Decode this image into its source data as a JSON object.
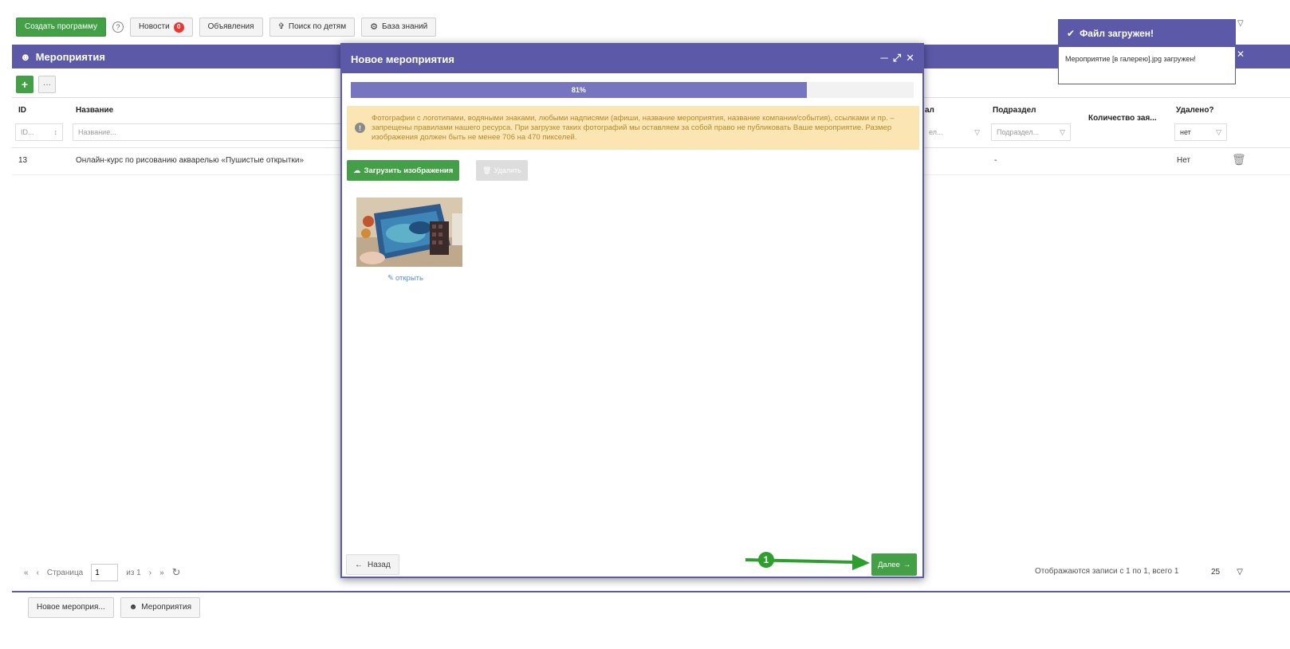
{
  "toolbar": {
    "create_program": "Создать программу",
    "help": "?",
    "news": "Новости",
    "news_badge": "0",
    "announcements": "Объявления",
    "search_children": "Поиск по детям",
    "knowledge_base": "База знаний"
  },
  "panel": {
    "title": "Мероприятия",
    "add": "+",
    "more": "···"
  },
  "grid": {
    "columns": {
      "id": "ID",
      "name": "Название",
      "col_partial": "ал",
      "subsection": "Подраздел",
      "applications_count": "Количество зая...",
      "deleted": "Удалено?"
    },
    "filters": {
      "id_placeholder": "ID...",
      "name_placeholder": "Название...",
      "partial_placeholder": "ел...",
      "subsection_placeholder": "Подраздел...",
      "deleted_value": "нет"
    },
    "rows": [
      {
        "id": "13",
        "name": "Онлайн-курс по рисованию акварелью «Пушистые открытки»",
        "subsection": "-",
        "deleted": "Нет"
      }
    ]
  },
  "pager": {
    "page_label": "Страница",
    "page_value": "1",
    "of_label": "из 1",
    "status": "Отображаются записи с 1 по 1, всего 1",
    "per_page": "25"
  },
  "tabs": {
    "new_event": "Новое мероприя...",
    "events": "Мероприятия"
  },
  "notification": {
    "title": "Файл загружен!",
    "message": "Мероприятие [в галерею].jpg загружен!"
  },
  "modal": {
    "title": "Новое мероприятия",
    "progress_label": "81%",
    "progress_value": 81,
    "warning": "Фотографии с логотипами, водяными знаками, любыми надписями (афиши, название мероприятия, название компании/события), ссылками и пр. – запрещены правилами нашего ресурса. При загрузке таких фотографий мы оставляем за собой право не публиковать Ваше мероприятие. Размер изображения должен быть не менее 706 на 470 пикселей.",
    "upload_button": "Загрузить изображения",
    "delete_button": "Удалить",
    "open_link": "открыть",
    "back_button": "Назад",
    "next_button": "Далее"
  },
  "annotation": {
    "step_number": "1"
  },
  "colors": {
    "header": "#5c5aa8",
    "green": "#43a047",
    "warning_bg": "#fbe6b3",
    "badge": "#e53935"
  }
}
